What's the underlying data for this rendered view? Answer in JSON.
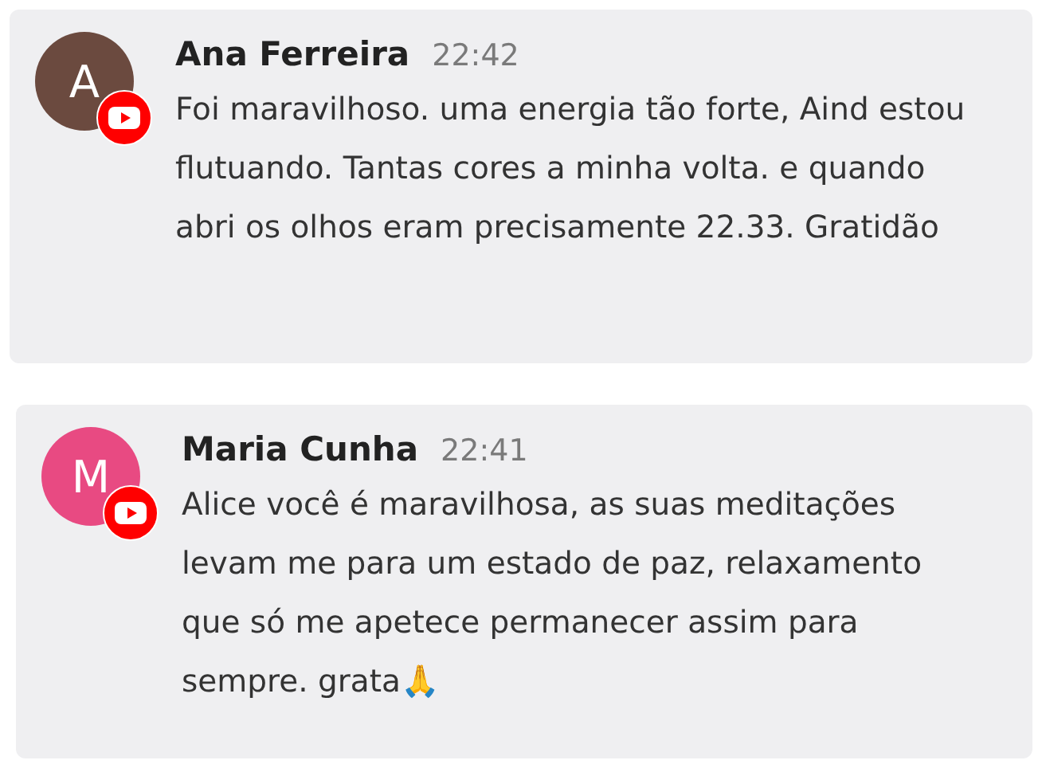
{
  "comments": [
    {
      "initial": "A",
      "color": "#6b4a3f",
      "author": "Ana Ferreira",
      "time": "22:42",
      "text": "Foi maravilhoso. uma energia tão forte, Aind estou flutuando. Tantas cores a minha volta. e quando abri os olhos eram precisamente 22.33. Gratidão"
    },
    {
      "initial": "M",
      "color": "#e84a82",
      "author": "Maria Cunha",
      "time": "22:41",
      "text": "Alice você é maravilhosa, as suas meditações levam me para um estado de paz, relaxamento que só me apetece permanecer assim para sempre. grata🙏"
    }
  ]
}
